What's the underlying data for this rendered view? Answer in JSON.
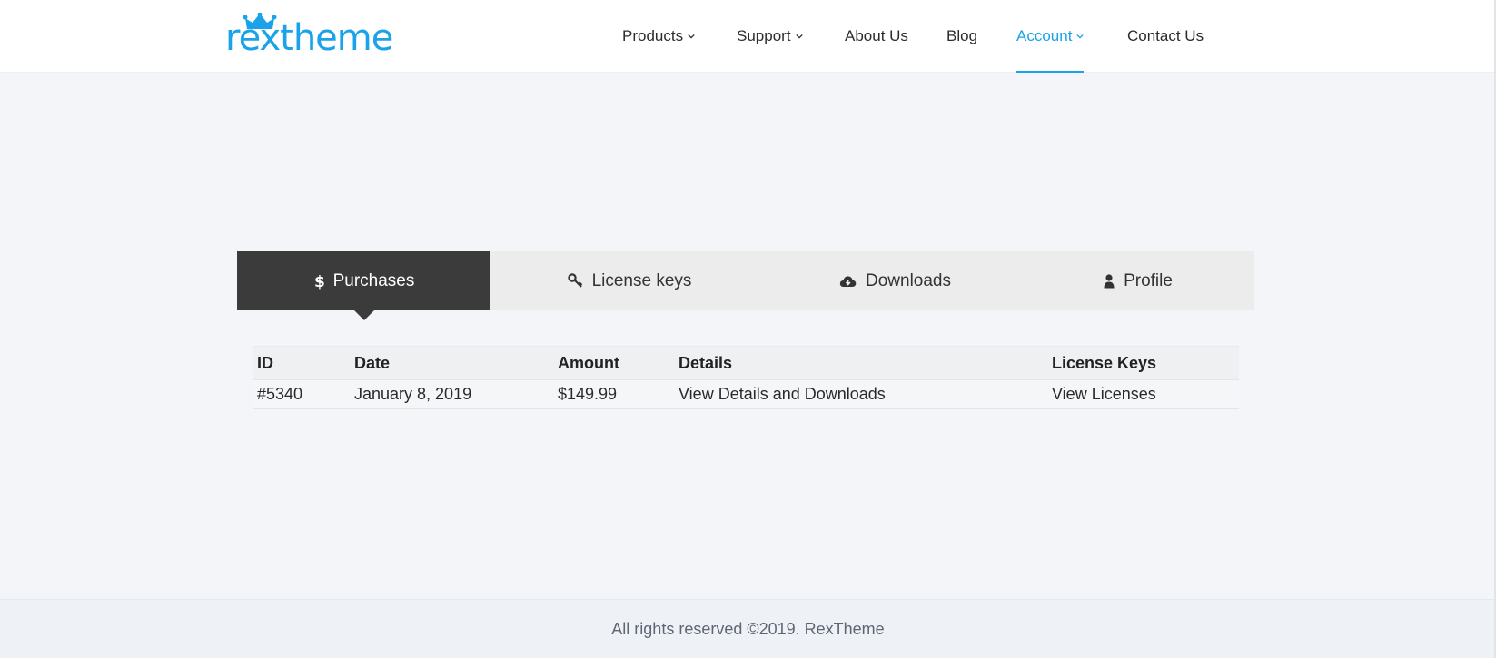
{
  "brand": {
    "logo_text": "rextheme",
    "accent": "#1aa3e8"
  },
  "nav": {
    "items": [
      {
        "label": "Products",
        "has_dropdown": true
      },
      {
        "label": "Support",
        "has_dropdown": true
      },
      {
        "label": "About Us",
        "has_dropdown": false
      },
      {
        "label": "Blog",
        "has_dropdown": false
      },
      {
        "label": "Account",
        "has_dropdown": true,
        "active": true
      },
      {
        "label": "Contact Us",
        "has_dropdown": false
      }
    ]
  },
  "tabs": [
    {
      "label": "Purchases",
      "icon": "dollar-icon",
      "active": true
    },
    {
      "label": "License keys",
      "icon": "key-icon",
      "active": false
    },
    {
      "label": "Downloads",
      "icon": "cloud-download-icon",
      "active": false
    },
    {
      "label": "Profile",
      "icon": "user-icon",
      "active": false
    }
  ],
  "table": {
    "headers": [
      "ID",
      "Date",
      "Amount",
      "Details",
      "License Keys"
    ],
    "rows": [
      {
        "id": "#5340",
        "date": "January 8, 2019",
        "amount": "$149.99",
        "details": "View Details and Downloads",
        "license_keys": "View Licenses"
      }
    ]
  },
  "footer": {
    "text": "All rights reserved ©2019. RexTheme"
  }
}
